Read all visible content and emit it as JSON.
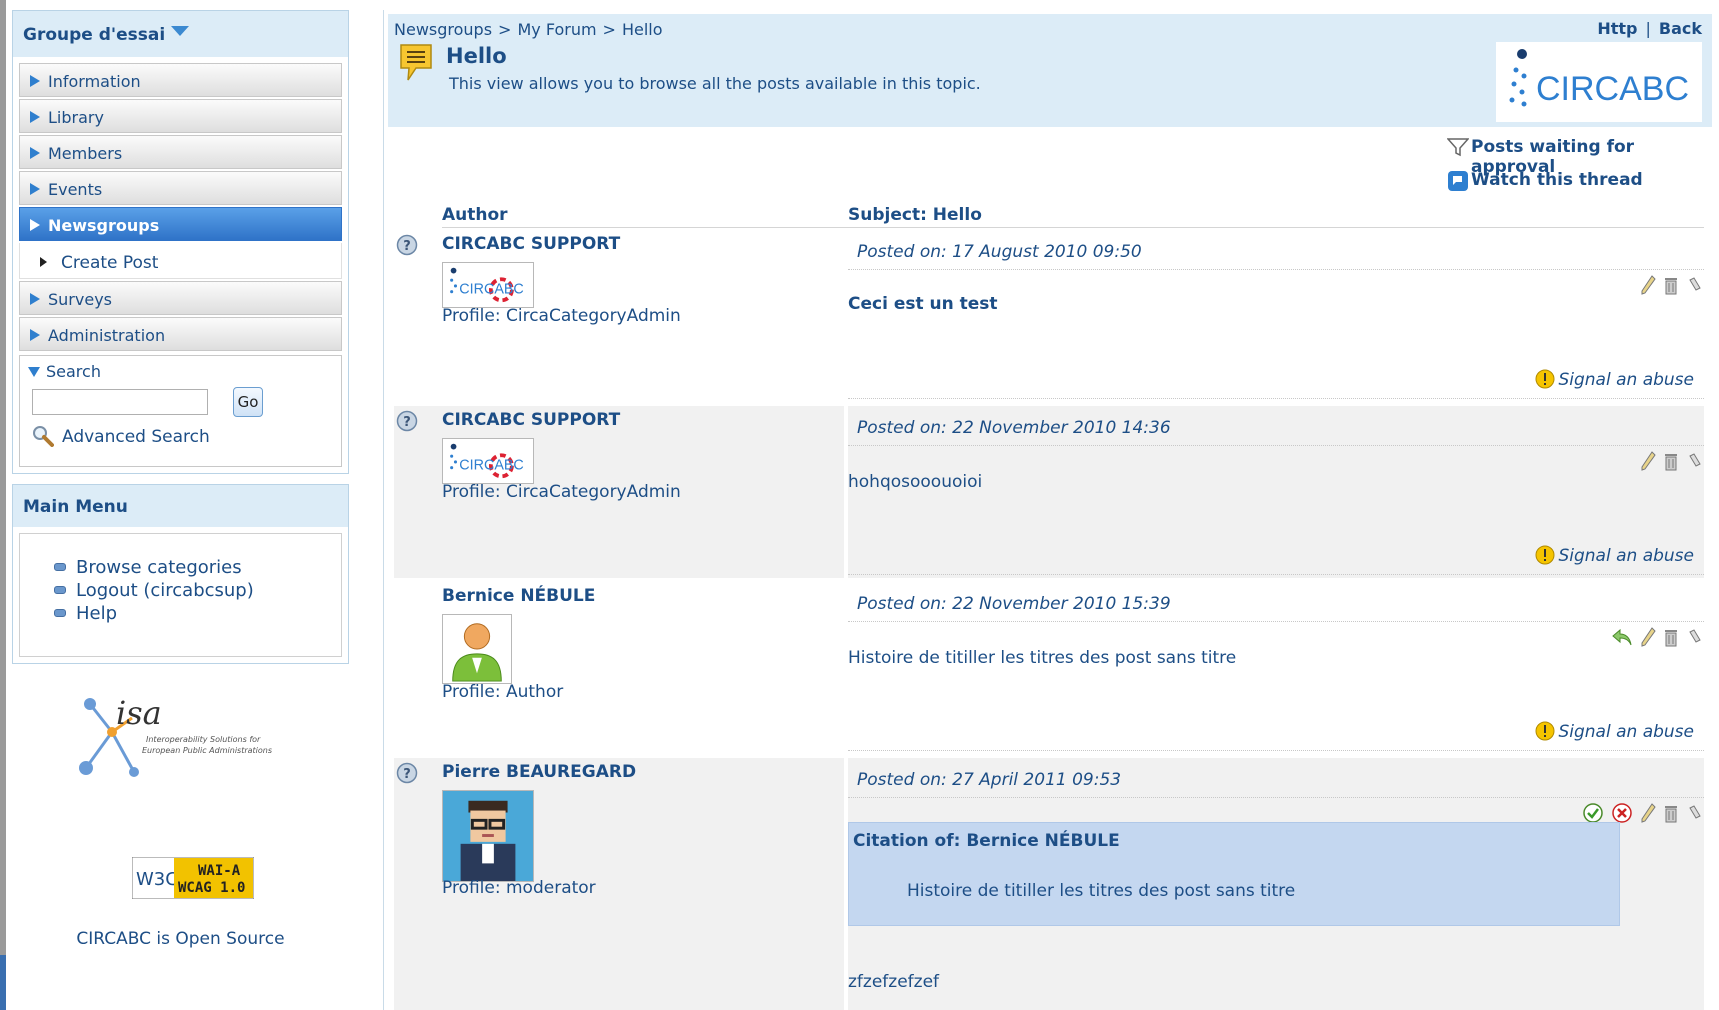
{
  "sidebar": {
    "group_title": "Groupe d'essai",
    "nav": [
      {
        "label": "Information"
      },
      {
        "label": "Library"
      },
      {
        "label": "Members"
      },
      {
        "label": "Events"
      },
      {
        "label": "Newsgroups",
        "active": true
      }
    ],
    "sub_item": "Create Post",
    "nav_after": [
      {
        "label": "Surveys"
      },
      {
        "label": "Administration"
      }
    ],
    "search": {
      "title": "Search",
      "value": "",
      "go_label": "Go",
      "advanced_label": "Advanced Search"
    },
    "main_menu": {
      "title": "Main Menu",
      "items": [
        {
          "label": "Browse categories"
        },
        {
          "label": "Logout (circabcsup)"
        },
        {
          "label": "Help"
        }
      ]
    },
    "isa_logo_text": "isa",
    "isa_tagline_1": "Interoperability Solutions for",
    "isa_tagline_2": "European Public Administrations",
    "w3c_badge": {
      "w3c": "W3C",
      "line1": "WAI-A",
      "line2": "WCAG 1.0"
    },
    "open_source": "CIRCABC is Open Source"
  },
  "header": {
    "breadcrumb": [
      "Newsgroups",
      "My Forum",
      "Hello"
    ],
    "breadcrumb_sep": ">",
    "links": {
      "http": "Http",
      "sep": "|",
      "back": "Back"
    },
    "title": "Hello",
    "description": "This view allows you to browse all the posts available in this topic.",
    "logo_text": "CIRCABC"
  },
  "actions": {
    "posts_waiting": "Posts waiting for approval",
    "watch_thread": "Watch this thread"
  },
  "table": {
    "author_header": "Author",
    "subject_header": "Subject: Hello",
    "posts": [
      {
        "author": "CIRCABC SUPPORT",
        "profile": "Profile: CircaCategoryAdmin",
        "posted": "Posted on: 17 August 2010 09:50",
        "body": "Ceci est un test",
        "signal": "Signal an abuse",
        "avatar": "circabc-logo"
      },
      {
        "author": "CIRCABC SUPPORT",
        "profile": "Profile: CircaCategoryAdmin",
        "posted": "Posted on: 22 November 2010 14:36",
        "body": "hohqosooouoioi",
        "signal": "Signal an abuse",
        "avatar": "circabc-logo"
      },
      {
        "author": "Bernice NÉBULE",
        "profile": "Profile: Author",
        "posted": "Posted on: 22 November 2010 15:39",
        "body": "Histoire de titiller les titres des post sans titre",
        "signal": "Signal an abuse",
        "avatar": "person-avatar"
      },
      {
        "author": "Pierre BEAUREGARD",
        "profile": "Profile: moderator",
        "posted": "Posted on: 27 April 2011 09:53",
        "quote_title": "Citation of: Bernice NÉBULE",
        "quote_text": "Histoire de titiller les titres des post sans titre",
        "body": "zfzefzefzef",
        "avatar": "pixel-avatar"
      }
    ]
  },
  "colors": {
    "link": "#1d4e86",
    "header_bg": "#dcecf7",
    "active_nav": "#2f73c8",
    "quote_bg": "#c4d7f0"
  }
}
